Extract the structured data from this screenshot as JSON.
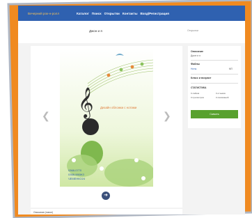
{
  "nav": {
    "logo": "Вечерний рок-н-ролл",
    "links": [
      "Каталог",
      "Поиск",
      "Открытки",
      "Контакты",
      "Вход/Регистрация"
    ]
  },
  "page": {
    "title": "Джон и я",
    "right_note": "Открытки"
  },
  "cover": {
    "headline": "Дизайн обложки с нотами",
    "lines": [
      "0368-0770",
      "0368-990ЖЗ",
      "ЧЕМЕНКО24"
    ]
  },
  "info": {
    "desc_label": "Описание",
    "desc_text": "Джон и я",
    "files_label": "Файлы",
    "files_link": "Ноты",
    "files_value": "МП",
    "size_label": "Класс и возраст",
    "options_label": "СТАТИСТИКА",
    "options": [
      "0 лайков",
      "0 отзывов",
      "0 просмотров",
      "0 скачиваний"
    ],
    "button": "Скачать"
  },
  "bottom": {
    "text": "Описание (новое)"
  }
}
